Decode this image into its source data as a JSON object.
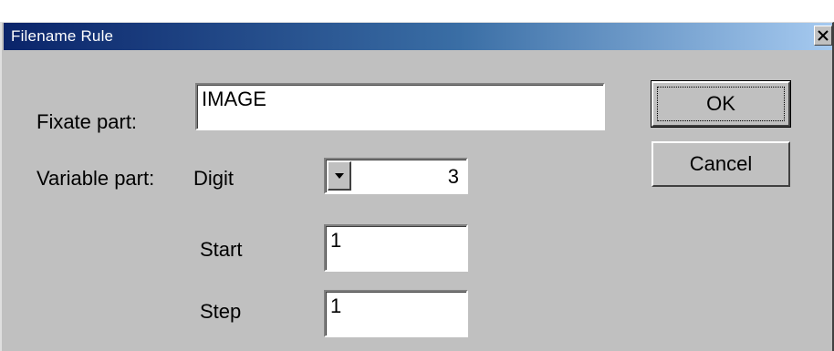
{
  "window": {
    "title": "Filename Rule",
    "close_label": "Close"
  },
  "form": {
    "fixate_label": "Fixate part:",
    "fixate_value": "IMAGE",
    "variable_label": "Variable part:",
    "digit_label": "Digit",
    "digit_value": "3",
    "start_label": "Start",
    "start_value": "1",
    "step_label": "Step",
    "step_value": "1"
  },
  "buttons": {
    "ok_label": "OK",
    "cancel_label": "Cancel"
  },
  "icons": {
    "close": "close-icon",
    "dropdown": "triangle-down-icon"
  }
}
